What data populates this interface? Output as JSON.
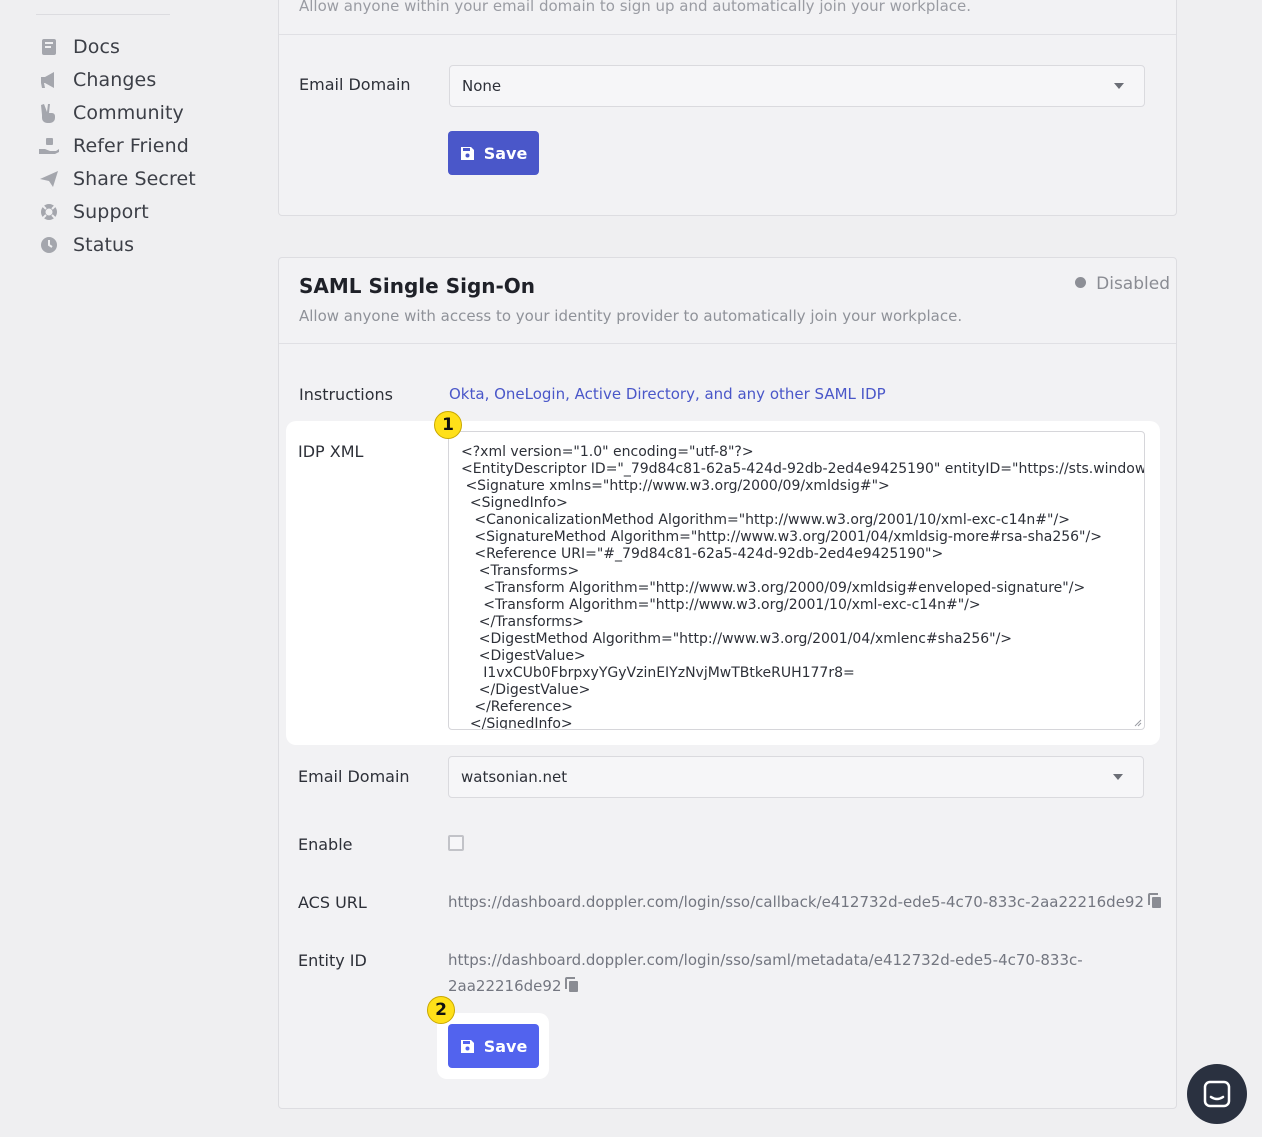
{
  "sidebar": {
    "items": [
      {
        "label": "Docs",
        "icon": "book-icon"
      },
      {
        "label": "Changes",
        "icon": "megaphone-icon"
      },
      {
        "label": "Community",
        "icon": "peace-hand-icon"
      },
      {
        "label": "Refer Friend",
        "icon": "hand-gift-icon"
      },
      {
        "label": "Share Secret",
        "icon": "paper-plane-icon"
      },
      {
        "label": "Support",
        "icon": "lifebuoy-icon"
      },
      {
        "label": "Status",
        "icon": "clock-icon"
      }
    ]
  },
  "domain_section": {
    "description": "Allow anyone within your email domain to sign up and automatically join your workplace.",
    "email_domain_label": "Email Domain",
    "email_domain_value": "None",
    "save_label": "Save"
  },
  "saml": {
    "title": "SAML Single Sign-On",
    "status": "Disabled",
    "description": "Allow anyone with access to your identity provider to automatically join your workplace.",
    "instructions_label": "Instructions",
    "instructions_link": "Okta, OneLogin, Active Directory, and any other SAML IDP",
    "idp_xml_label": "IDP XML",
    "idp_xml_lines": [
      "<?xml version=\"1.0\" encoding=\"utf-8\"?>",
      "<EntityDescriptor ID=\"_79d84c81-62a5-424d-92db-2ed4e9425190\" entityID=\"https://sts.windows.net/",
      " <Signature xmlns=\"http://www.w3.org/2000/09/xmldsig#\">",
      "  <SignedInfo>",
      "   <CanonicalizationMethod Algorithm=\"http://www.w3.org/2001/10/xml-exc-c14n#\"/>",
      "   <SignatureMethod Algorithm=\"http://www.w3.org/2001/04/xmldsig-more#rsa-sha256\"/>",
      "   <Reference URI=\"#_79d84c81-62a5-424d-92db-2ed4e9425190\">",
      "    <Transforms>",
      "     <Transform Algorithm=\"http://www.w3.org/2000/09/xmldsig#enveloped-signature\"/>",
      "     <Transform Algorithm=\"http://www.w3.org/2001/10/xml-exc-c14n#\"/>",
      "    </Transforms>",
      "    <DigestMethod Algorithm=\"http://www.w3.org/2001/04/xmlenc#sha256\"/>",
      "    <DigestValue>",
      "     I1vxCUb0FbrpxyYGyVzinEIYzNvjMwTBtkeRUH177r8=",
      "    </DigestValue>",
      "   </Reference>",
      "  </SignedInfo>"
    ],
    "email_domain_label": "Email Domain",
    "email_domain_value": "watsonian.net",
    "enable_label": "Enable",
    "enabled": false,
    "acs_url_label": "ACS URL",
    "acs_url": "https://dashboard.doppler.com/login/sso/callback/e412732d-ede5-4c70-833c-2aa22216de92",
    "entity_id_label": "Entity ID",
    "entity_id_line1": "https://dashboard.doppler.com/login/sso/saml/metadata/e412732d-ede5-4c70-833c-",
    "entity_id_line2": "2aa22216de92",
    "save_label": "Save"
  },
  "callouts": {
    "first": "1",
    "second": "2"
  },
  "colors": {
    "accent": "#4a57c9",
    "accent_bright": "#5263ee",
    "badge": "#ffe019",
    "chat": "#2a3140"
  }
}
